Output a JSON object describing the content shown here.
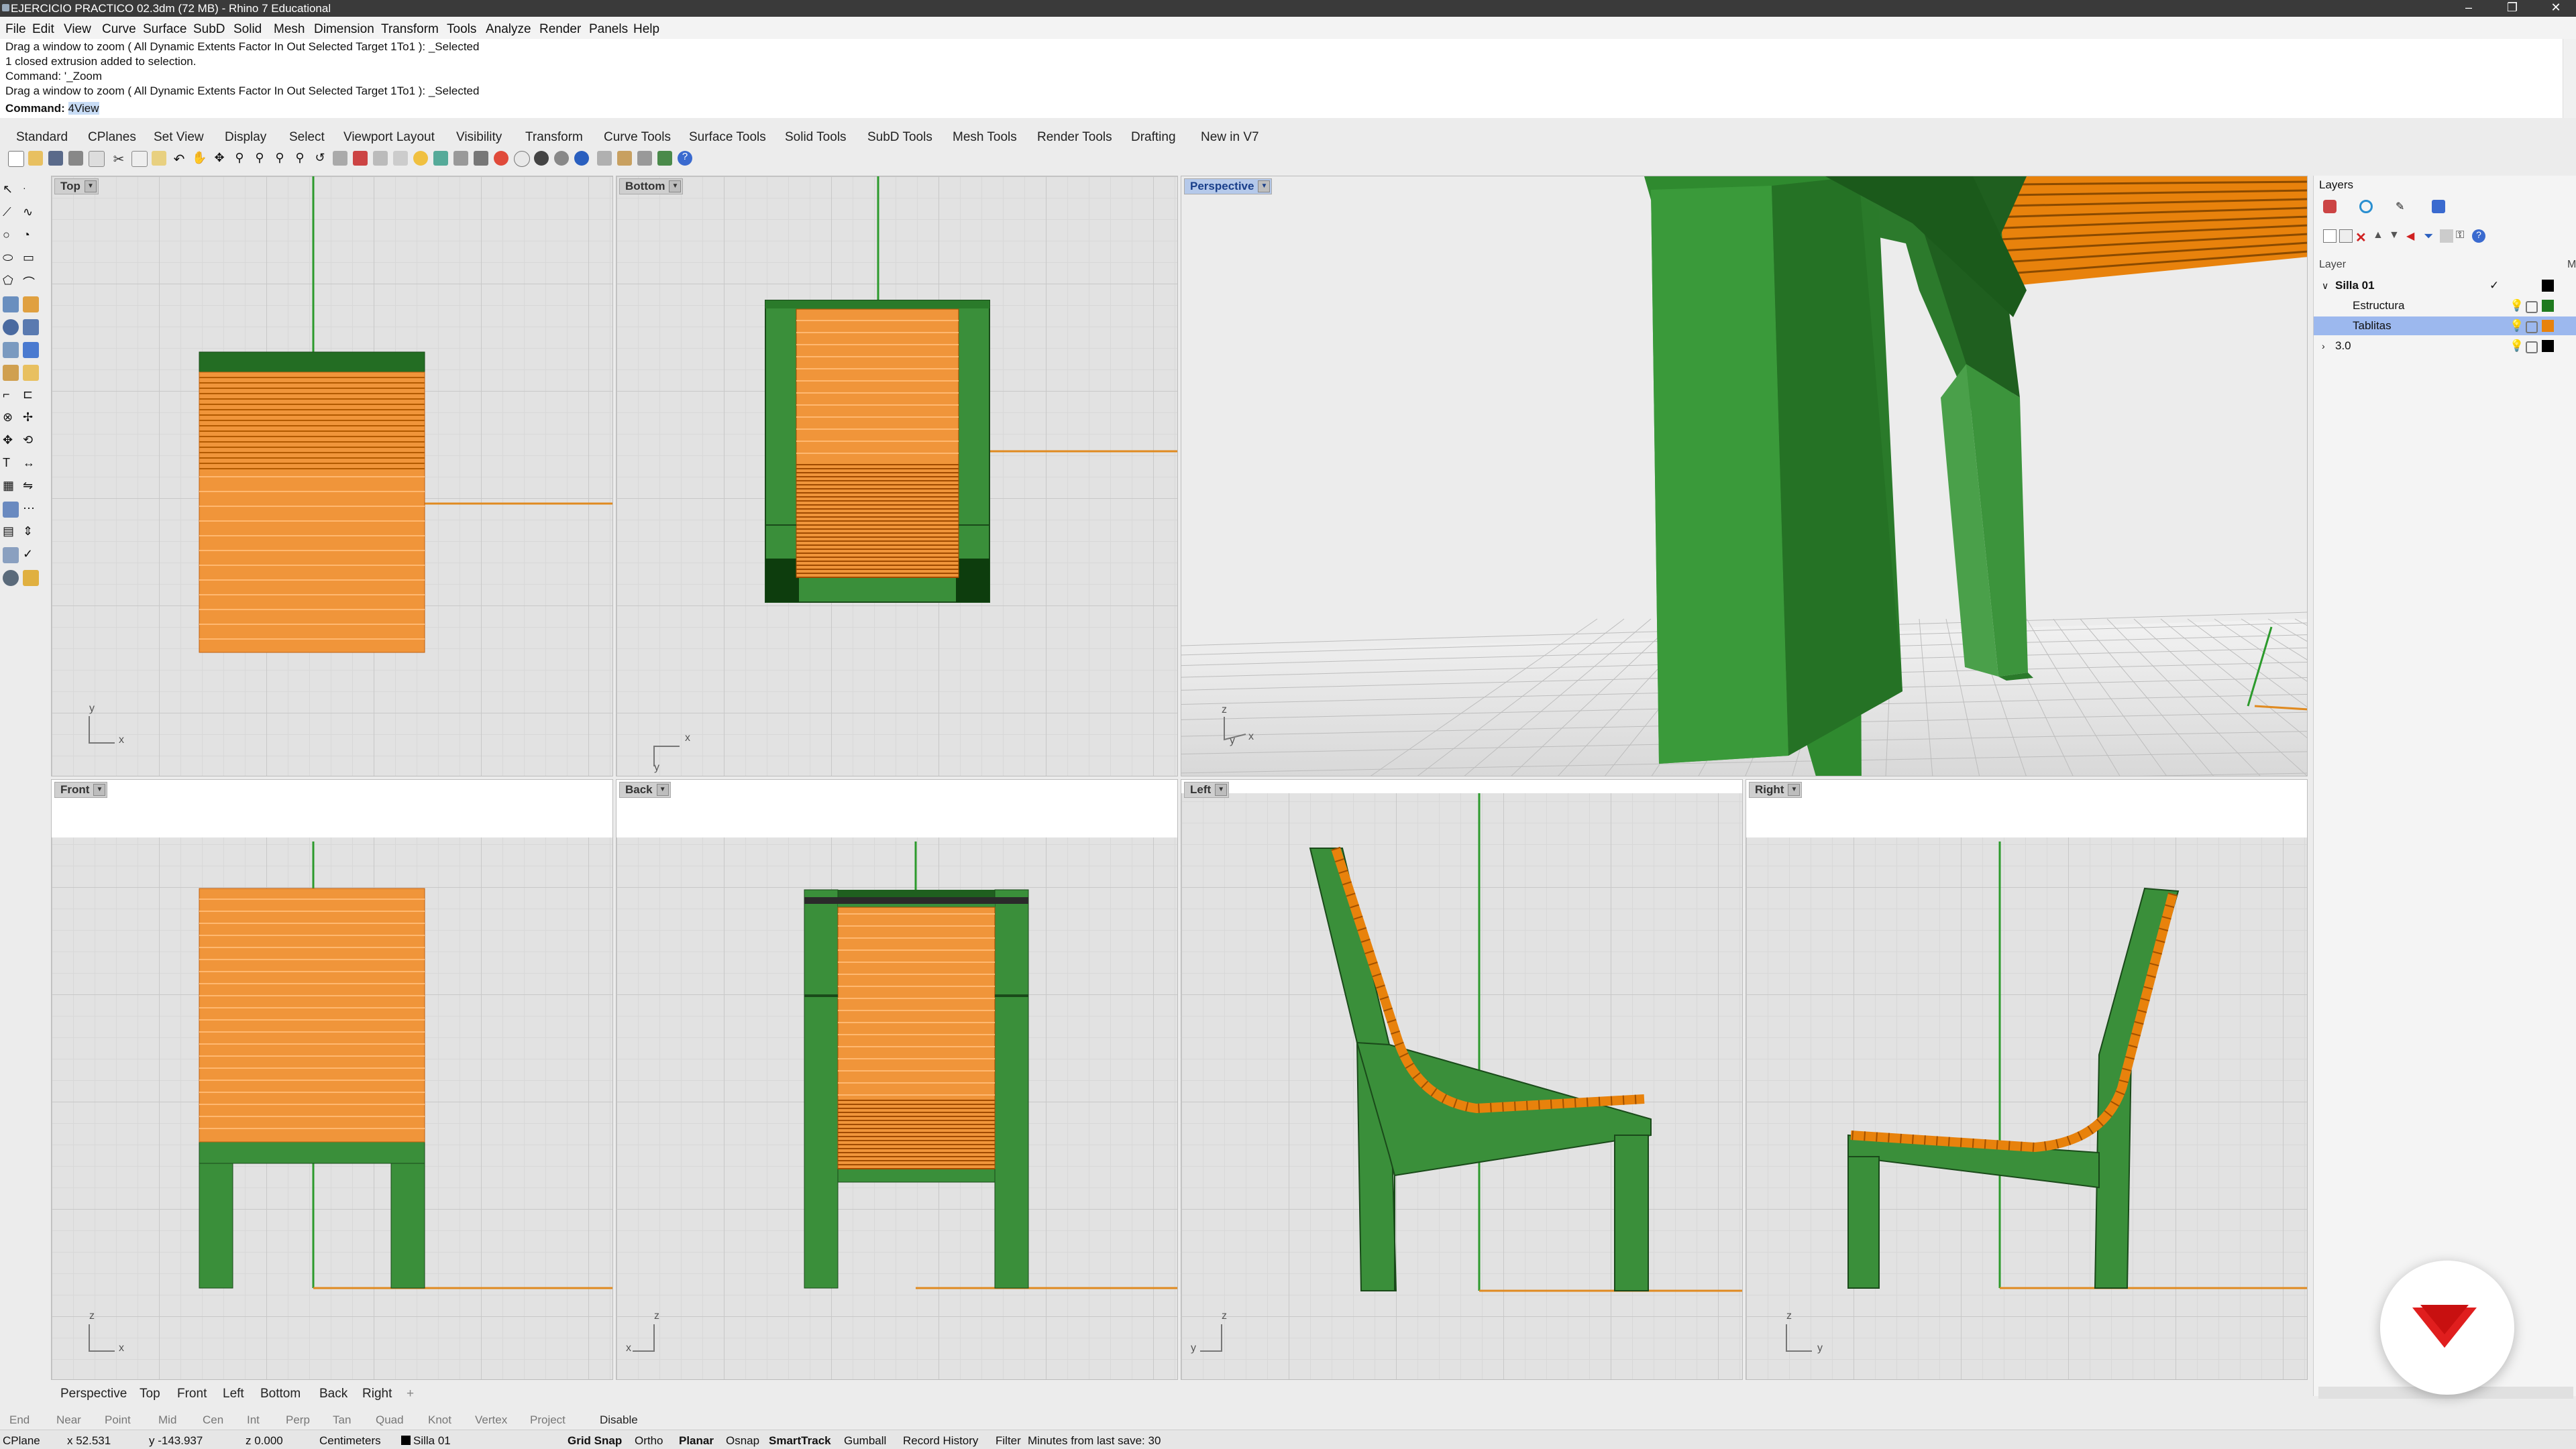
{
  "titlebar": {
    "title": "EJERCICIO PRACTICO 02.3dm (72 MB) - Rhino 7 Educational"
  },
  "menu": [
    "File",
    "Edit",
    "View",
    "Curve",
    "Surface",
    "SubD",
    "Solid",
    "Mesh",
    "Dimension",
    "Transform",
    "Tools",
    "Analyze",
    "Render",
    "Panels",
    "Help"
  ],
  "command_history": [
    "Drag a window to zoom ( All  Dynamic  Extents  Factor  In  Out  Selected  Target  1To1 ): _Selected",
    "1 closed extrusion added to selection.",
    "Command: '_Zoom",
    "Drag a window to zoom ( All  Dynamic  Extents  Factor  In  Out  Selected  Target  1To1 ): _Selected"
  ],
  "command_prompt": {
    "label": "Command:",
    "value": "4View"
  },
  "toolbar_tabs": [
    "Standard",
    "CPlanes",
    "Set View",
    "Display",
    "Select",
    "Viewport Layout",
    "Visibility",
    "Transform",
    "Curve Tools",
    "Surface Tools",
    "Solid Tools",
    "SubD Tools",
    "Mesh Tools",
    "Render Tools",
    "Drafting",
    "New in V7"
  ],
  "viewports": {
    "top": "Top",
    "bottom": "Bottom",
    "perspective": "Perspective",
    "front": "Front",
    "back": "Back",
    "left": "Left",
    "right": "Right"
  },
  "axis_labels": {
    "x": "x",
    "y": "y",
    "z": "z"
  },
  "layers_panel": {
    "title": "Layers",
    "col_layer": "Layer",
    "col_m": "M",
    "rows": [
      {
        "name": "Silla 01",
        "check": "✓",
        "color": "#000000"
      },
      {
        "name": "Estructura",
        "color": "#1f7a1f"
      },
      {
        "name": "Tablitas",
        "color": "#e8820c"
      },
      {
        "name": "3.0",
        "color": "#000000"
      }
    ]
  },
  "bottom_tabs": [
    "Perspective",
    "Top",
    "Front",
    "Left",
    "Bottom",
    "Back",
    "Right",
    "+"
  ],
  "osnaps": [
    "End",
    "Near",
    "Point",
    "Mid",
    "Cen",
    "Int",
    "Perp",
    "Tan",
    "Quad",
    "Knot",
    "Vertex",
    "Project",
    "Disable"
  ],
  "status": {
    "cplane": "CPlane",
    "x": "x 52.531",
    "y": "y -143.937",
    "z": "z 0.000",
    "units": "Centimeters",
    "layer": "Silla 01",
    "toggles": [
      "Grid Snap",
      "Ortho",
      "Planar",
      "Osnap",
      "SmartTrack",
      "Gumball",
      "Record History",
      "Filter"
    ],
    "message": "Minutes from last save: 30"
  },
  "colors": {
    "wood": "#e8820c",
    "wood_light": "#f0a050",
    "frame": "#2f8a2f",
    "frame_dark": "#1f6a1f",
    "selection": "#9cb8ee"
  }
}
